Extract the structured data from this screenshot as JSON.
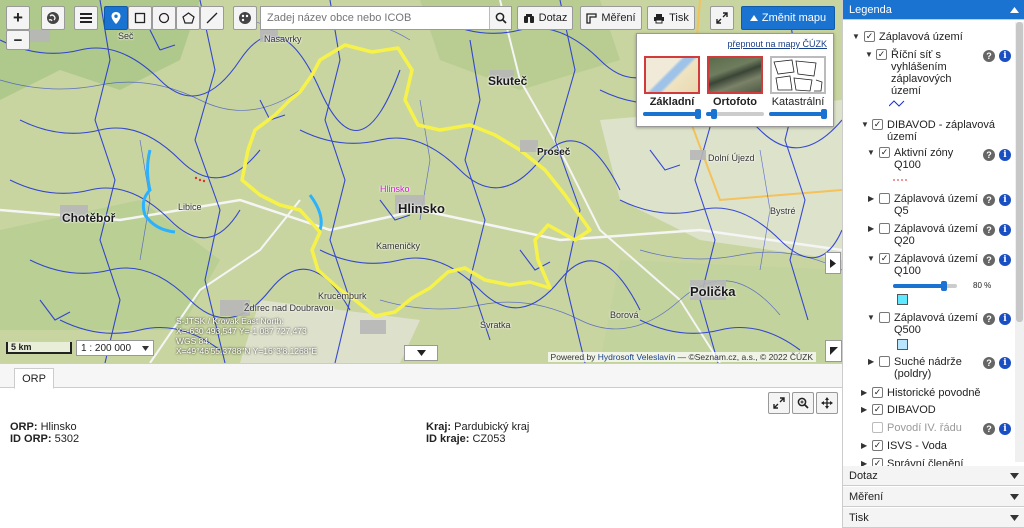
{
  "colors": {
    "accent": "#1a73d1",
    "flood_outline": "#f7f24a",
    "river": "#1b2fd6",
    "q100_swatch": "#5fe8ff",
    "q500_swatch": "#b8e6ff"
  },
  "toolbar": {
    "zoom_in": "+",
    "zoom_out": "−",
    "search_placeholder": "Zadej název obce nebo ICOB",
    "query_label": "Dotaz",
    "measure_label": "Měření",
    "print_label": "Tisk",
    "change_map_label": "Změnit mapu"
  },
  "map_switch": {
    "link": "přepnout na mapy ČÚZK",
    "basemaps": [
      {
        "label": "Základní",
        "selected": true,
        "opacity": 1.0
      },
      {
        "label": "Ortofoto",
        "selected": false,
        "opacity": 0.1
      },
      {
        "label": "Katastrální",
        "selected": false,
        "opacity": 1.0
      }
    ]
  },
  "places": {
    "skutec": "Skuteč",
    "prosec": "Proseč",
    "chotebor": "Chotěboř",
    "hlinsko": "Hlinsko",
    "hlinsko_marker": "Hlinsko",
    "policka": "Polička",
    "nasavrky": "Nasavrky",
    "sec": "Seč",
    "dolni_ujezd": "Dolní Újezd",
    "kamenice": "Kameničky",
    "krucemburk": "Krucemburk",
    "zdirec": "Ždírec nad Doubravou",
    "svratka": "Svratka",
    "borova": "Borová",
    "bystre": "Bystré",
    "libice": "Libice"
  },
  "scale": {
    "bar_label": "5 km",
    "ratio": "1 : 200 000"
  },
  "coords": {
    "line1": "S-JTSK / Krovak East North:",
    "line2": "X=-630 493,547 Y=-1 087 727,473",
    "line3": "WGS 84:",
    "line4": "X=49°46'55.3788\"N Y=16°3'8.1268\"E"
  },
  "attribution": {
    "prefix": "Powered by ",
    "link": "Hydrosoft Veleslavín",
    "rest": " — ©Seznam.cz, a.s., © 2022 ČÚZK"
  },
  "bottom": {
    "tab": "ORP",
    "left": {
      "orp_label": "ORP:",
      "orp_value": "Hlinsko",
      "id_label": "ID ORP:",
      "id_value": "5302"
    },
    "right": {
      "kraj_label": "Kraj:",
      "kraj_value": "Pardubický kraj",
      "id_label": "ID kraje:",
      "id_value": "CZ053"
    }
  },
  "legend": {
    "title": "Legenda",
    "items": {
      "zaplavova": "Záplavová území",
      "ricni_sit": "Říční síť s vyhlášením záplavových území",
      "dibavod_zap": "DIBAVOD - záplavová území",
      "aktivni": "Aktivní zóny Q100",
      "q5": "Záplavová území Q5",
      "q20": "Záplavová území Q20",
      "q100": "Záplavová území Q100",
      "q100_opacity": "80 %",
      "q500": "Záplavová území Q500",
      "suche": "Suché nádrže (poldry)",
      "historicke": "Historické povodně",
      "dibavod": "DIBAVOD",
      "povodi": "Povodí IV. řádu",
      "isvs": "ISVS - Voda",
      "spravni": "Správní členění"
    }
  },
  "panels": {
    "dotaz": "Dotaz",
    "mereni": "Měření",
    "tisk": "Tisk"
  }
}
